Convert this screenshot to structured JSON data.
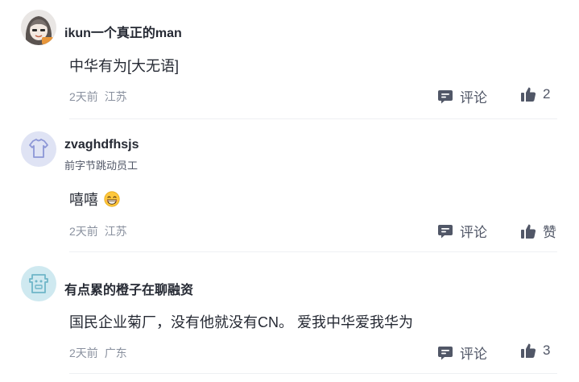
{
  "comments": [
    {
      "username": "ikun一个真正的man",
      "user_title": "",
      "content": "中华有为[大无语]",
      "time": "2天前",
      "location": "江苏",
      "comment_label": "评论",
      "like_label": "2"
    },
    {
      "username": "zvaghdfhsjs",
      "user_title": "前字节跳动员工",
      "content": "嘻嘻",
      "content_emoji": "grinning-face-emoji",
      "time": "2天前",
      "location": "江苏",
      "comment_label": "评论",
      "like_label": "赞"
    },
    {
      "username": "有点累的橙子在聊融资",
      "user_title": "",
      "content": "国民企业菊厂，没有他就没有CN。 爱我中华爱我华为",
      "time": "2天前",
      "location": "广东",
      "comment_label": "评论",
      "like_label": "3"
    }
  ],
  "icons": {
    "comment": "comment-bubble-icon",
    "like": "thumbs-up-icon"
  },
  "colors": {
    "text_primary": "#252933",
    "text_secondary": "#515767",
    "text_meta": "#8a919f",
    "icon": "#515767",
    "divider": "#eef0f3"
  }
}
